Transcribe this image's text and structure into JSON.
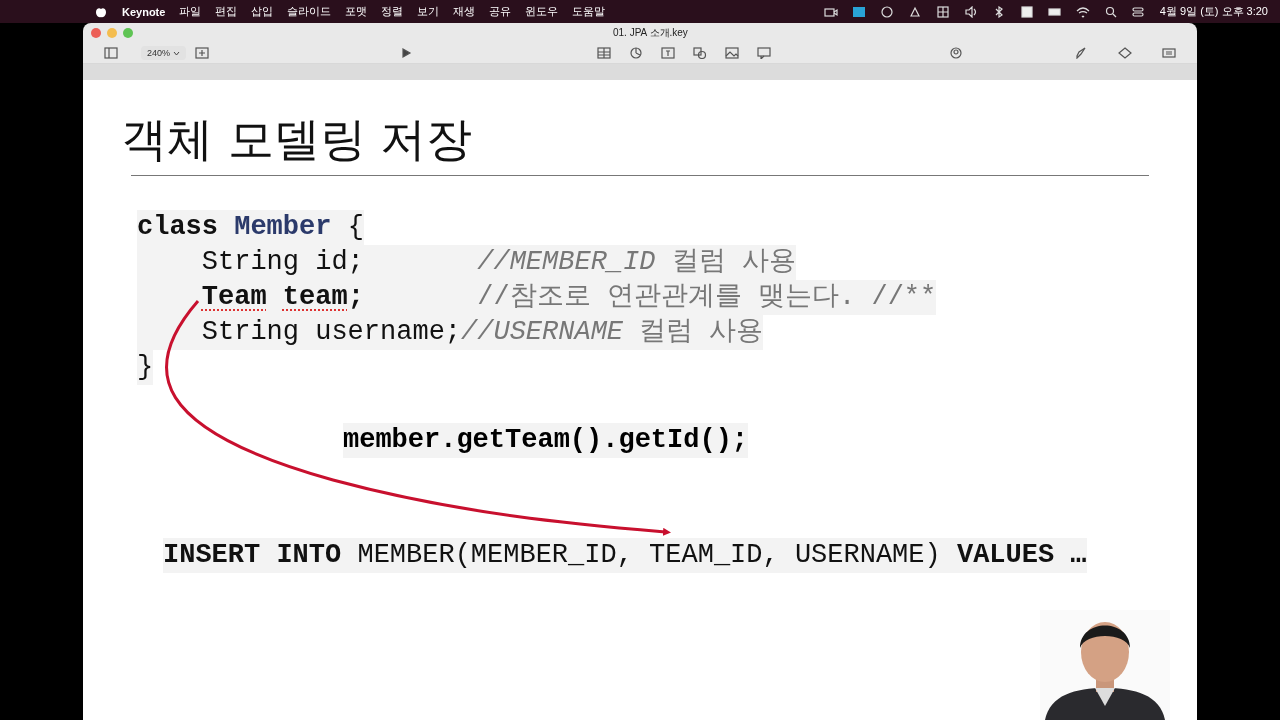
{
  "menu_bar": {
    "app": "Keynote",
    "menus": [
      "파일",
      "편집",
      "삽입",
      "슬라이드",
      "포맷",
      "정렬",
      "보기",
      "재생",
      "공유",
      "윈도우",
      "도움말"
    ],
    "clock": "4월 9일 (토) 오후 3:20"
  },
  "window": {
    "title": "01. JPA 소개.key",
    "zoom": "240%"
  },
  "slide": {
    "title": "객체 모델링 저장",
    "code": [
      {
        "segments": [
          {
            "kind": "keyword",
            "text": "class "
          },
          {
            "kind": "class-name",
            "text": "Member"
          },
          {
            "kind": "plain",
            "text": " {"
          }
        ]
      },
      {
        "indented": true,
        "segments": [
          {
            "kind": "plain",
            "text": "String id;       "
          },
          {
            "kind": "comment",
            "text": "//MEMBER_ID"
          },
          {
            "kind": "comment-text",
            "text": " 컬럼 사용"
          }
        ]
      },
      {
        "indented": true,
        "segments": [
          {
            "kind": "flagged",
            "text": "Team team"
          },
          {
            "kind": "keyword",
            "text": ";       "
          },
          {
            "kind": "comment-text",
            "text": "//참조로 연관관계를 맺는다. //**"
          }
        ]
      },
      {
        "indented": true,
        "segments": [
          {
            "kind": "plain",
            "text": "String username;"
          },
          {
            "kind": "comment",
            "text": "//USERNAME"
          },
          {
            "kind": "comment-text",
            "text": " 컬럼 사용"
          }
        ]
      },
      {
        "segments": [
          {
            "kind": "plain",
            "text": "}"
          }
        ]
      }
    ],
    "call": "member.getTeam().getId();",
    "sql": [
      {
        "kind": "keyword",
        "text": "INSERT INTO"
      },
      {
        "kind": "plain",
        "text": " MEMBER(MEMBER_ID, TEAM_ID, USERNAME) "
      },
      {
        "kind": "keyword",
        "text": "VALUES …"
      }
    ]
  }
}
